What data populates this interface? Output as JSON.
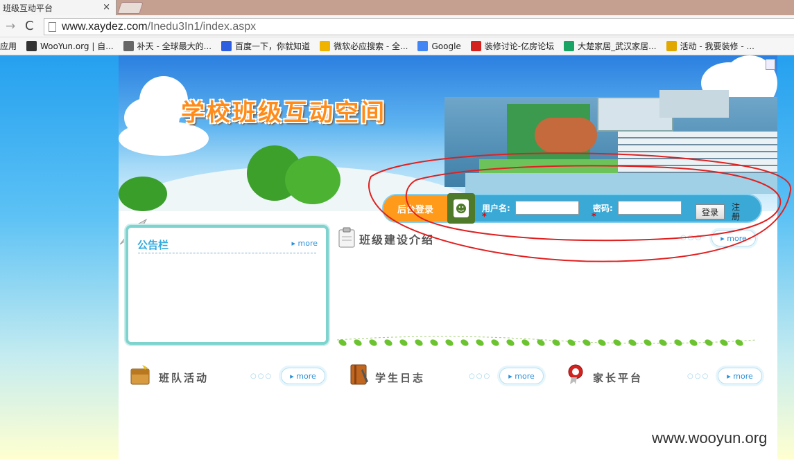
{
  "browser": {
    "tab_title": "班级互动平台",
    "tab_close": "×",
    "url_host": "www.xaydez.com",
    "url_path": "/Inedu3In1/index.aspx",
    "back_glyph": "→",
    "reload_glyph": "C",
    "bookmarks": [
      {
        "label": "应用",
        "icon": "apps-icon",
        "color": "#3b78e7"
      },
      {
        "label": "WooYun.org | 自...",
        "icon": "wooyun-icon",
        "color": "#333333"
      },
      {
        "label": "补天 - 全球最大的...",
        "icon": "butian-icon",
        "color": "#666666"
      },
      {
        "label": "百度一下，你就知道",
        "icon": "baidu-icon",
        "color": "#2e5ee0"
      },
      {
        "label": "微软必应搜索 - 全...",
        "icon": "bing-icon",
        "color": "#f0b400"
      },
      {
        "label": "Google",
        "icon": "google-icon",
        "color": "#4285f4"
      },
      {
        "label": "装修讨论-亿房论坛",
        "icon": "fang-icon",
        "color": "#d3221d"
      },
      {
        "label": "大楚家居_武汉家居...",
        "icon": "dachu-icon",
        "color": "#19a463"
      },
      {
        "label": "活动 - 我要装修 - ...",
        "icon": "chrome-icon",
        "color": "#e0a800"
      }
    ]
  },
  "site": {
    "title": "学校班级互动空间",
    "login": {
      "label": "后台登录",
      "username_label": "用户名:",
      "password_label": "密码:",
      "required_mark": "*",
      "submit": "登录",
      "register": "注册"
    },
    "notice": {
      "title": "公告栏",
      "more": "▸ more"
    },
    "intro": {
      "title": "班级建设介绍",
      "more": "▸ more"
    },
    "sections": [
      {
        "title": "班队活动",
        "more": "▸ more",
        "icon": "briefcase-icon"
      },
      {
        "title": "学生日志",
        "more": "▸ more",
        "icon": "notebook-icon"
      },
      {
        "title": "家长平台",
        "more": "▸ more",
        "icon": "rosette-icon"
      }
    ]
  },
  "watermark": "www.wooyun.org",
  "colors": {
    "accent_orange": "#ff8c1a",
    "login_blue": "#3aa9d6",
    "annotation_red": "#e02020"
  }
}
